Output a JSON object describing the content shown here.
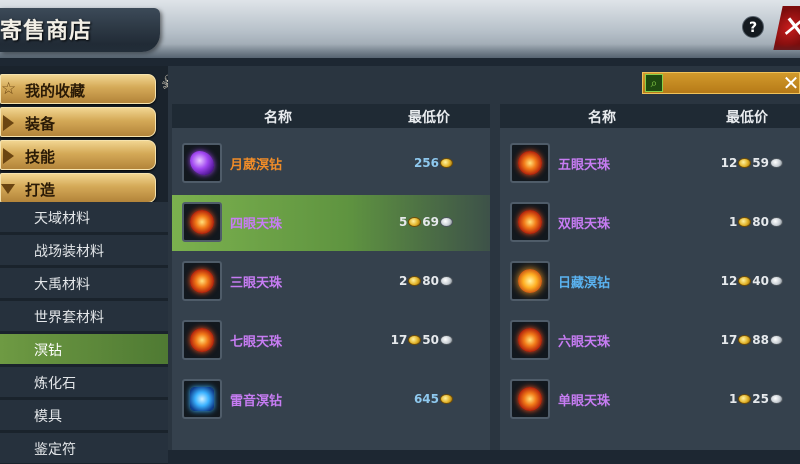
{
  "window": {
    "title": "寄售商店"
  },
  "header": {
    "help_label": "?",
    "close_label": "✕"
  },
  "search": {
    "clear_label": "✕",
    "icon": "search-icon"
  },
  "sidebar": {
    "categories": [
      {
        "label": "我的收藏",
        "marker": "star",
        "expanded": false
      },
      {
        "label": "装备",
        "marker": "triangle-right",
        "expanded": false
      },
      {
        "label": "技能",
        "marker": "triangle-right",
        "expanded": false
      },
      {
        "label": "打造",
        "marker": "triangle-down",
        "expanded": true
      }
    ],
    "subitems": [
      {
        "label": "天域材料"
      },
      {
        "label": "战场装材料"
      },
      {
        "label": "大禹材料"
      },
      {
        "label": "世界套材料"
      },
      {
        "label": "溟钻",
        "selected": true
      },
      {
        "label": "炼化石"
      },
      {
        "label": "模具"
      },
      {
        "label": "鉴定符"
      }
    ]
  },
  "columns": {
    "name": "名称",
    "price": "最低价"
  },
  "left_items": [
    {
      "name": "月葳溟钻",
      "name_color": "#f08c28",
      "icon": "purple",
      "price_a": "256",
      "price_b": "",
      "style": "blue"
    },
    {
      "name": "四眼天珠",
      "name_color": "#c67cf2",
      "icon": "fire",
      "price_a": "5",
      "price_b": "69",
      "style": "gold-silver",
      "selected": true
    },
    {
      "name": "三眼天珠",
      "name_color": "#c67cf2",
      "icon": "fire",
      "price_a": "2",
      "price_b": "80",
      "style": "gold-silver"
    },
    {
      "name": "七眼天珠",
      "name_color": "#c67cf2",
      "icon": "fire",
      "price_a": "17",
      "price_b": "50",
      "style": "gold-silver"
    },
    {
      "name": "雷音溟钻",
      "name_color": "#c67cf2",
      "icon": "blue",
      "price_a": "645",
      "price_b": "",
      "style": "blue"
    }
  ],
  "right_items": [
    {
      "name": "五眼天珠",
      "name_color": "#c67cf2",
      "icon": "fire",
      "price_a": "12",
      "price_b": "59",
      "style": "gold-silver"
    },
    {
      "name": "双眼天珠",
      "name_color": "#c67cf2",
      "icon": "fire",
      "price_a": "1",
      "price_b": "80",
      "style": "gold-silver"
    },
    {
      "name": "日藏溟钻",
      "name_color": "#5ab2f0",
      "icon": "sun",
      "price_a": "12",
      "price_b": "40",
      "style": "gold-silver"
    },
    {
      "name": "六眼天珠",
      "name_color": "#c67cf2",
      "icon": "fire",
      "price_a": "17",
      "price_b": "88",
      "style": "gold-silver"
    },
    {
      "name": "单眼天珠",
      "name_color": "#c67cf2",
      "icon": "fire",
      "price_a": "1",
      "price_b": "25",
      "style": "gold-silver"
    }
  ],
  "colors": {
    "gold_accent": "#d4a957",
    "selected_row": "#7bb14e",
    "panel_bg": "#35414d"
  }
}
